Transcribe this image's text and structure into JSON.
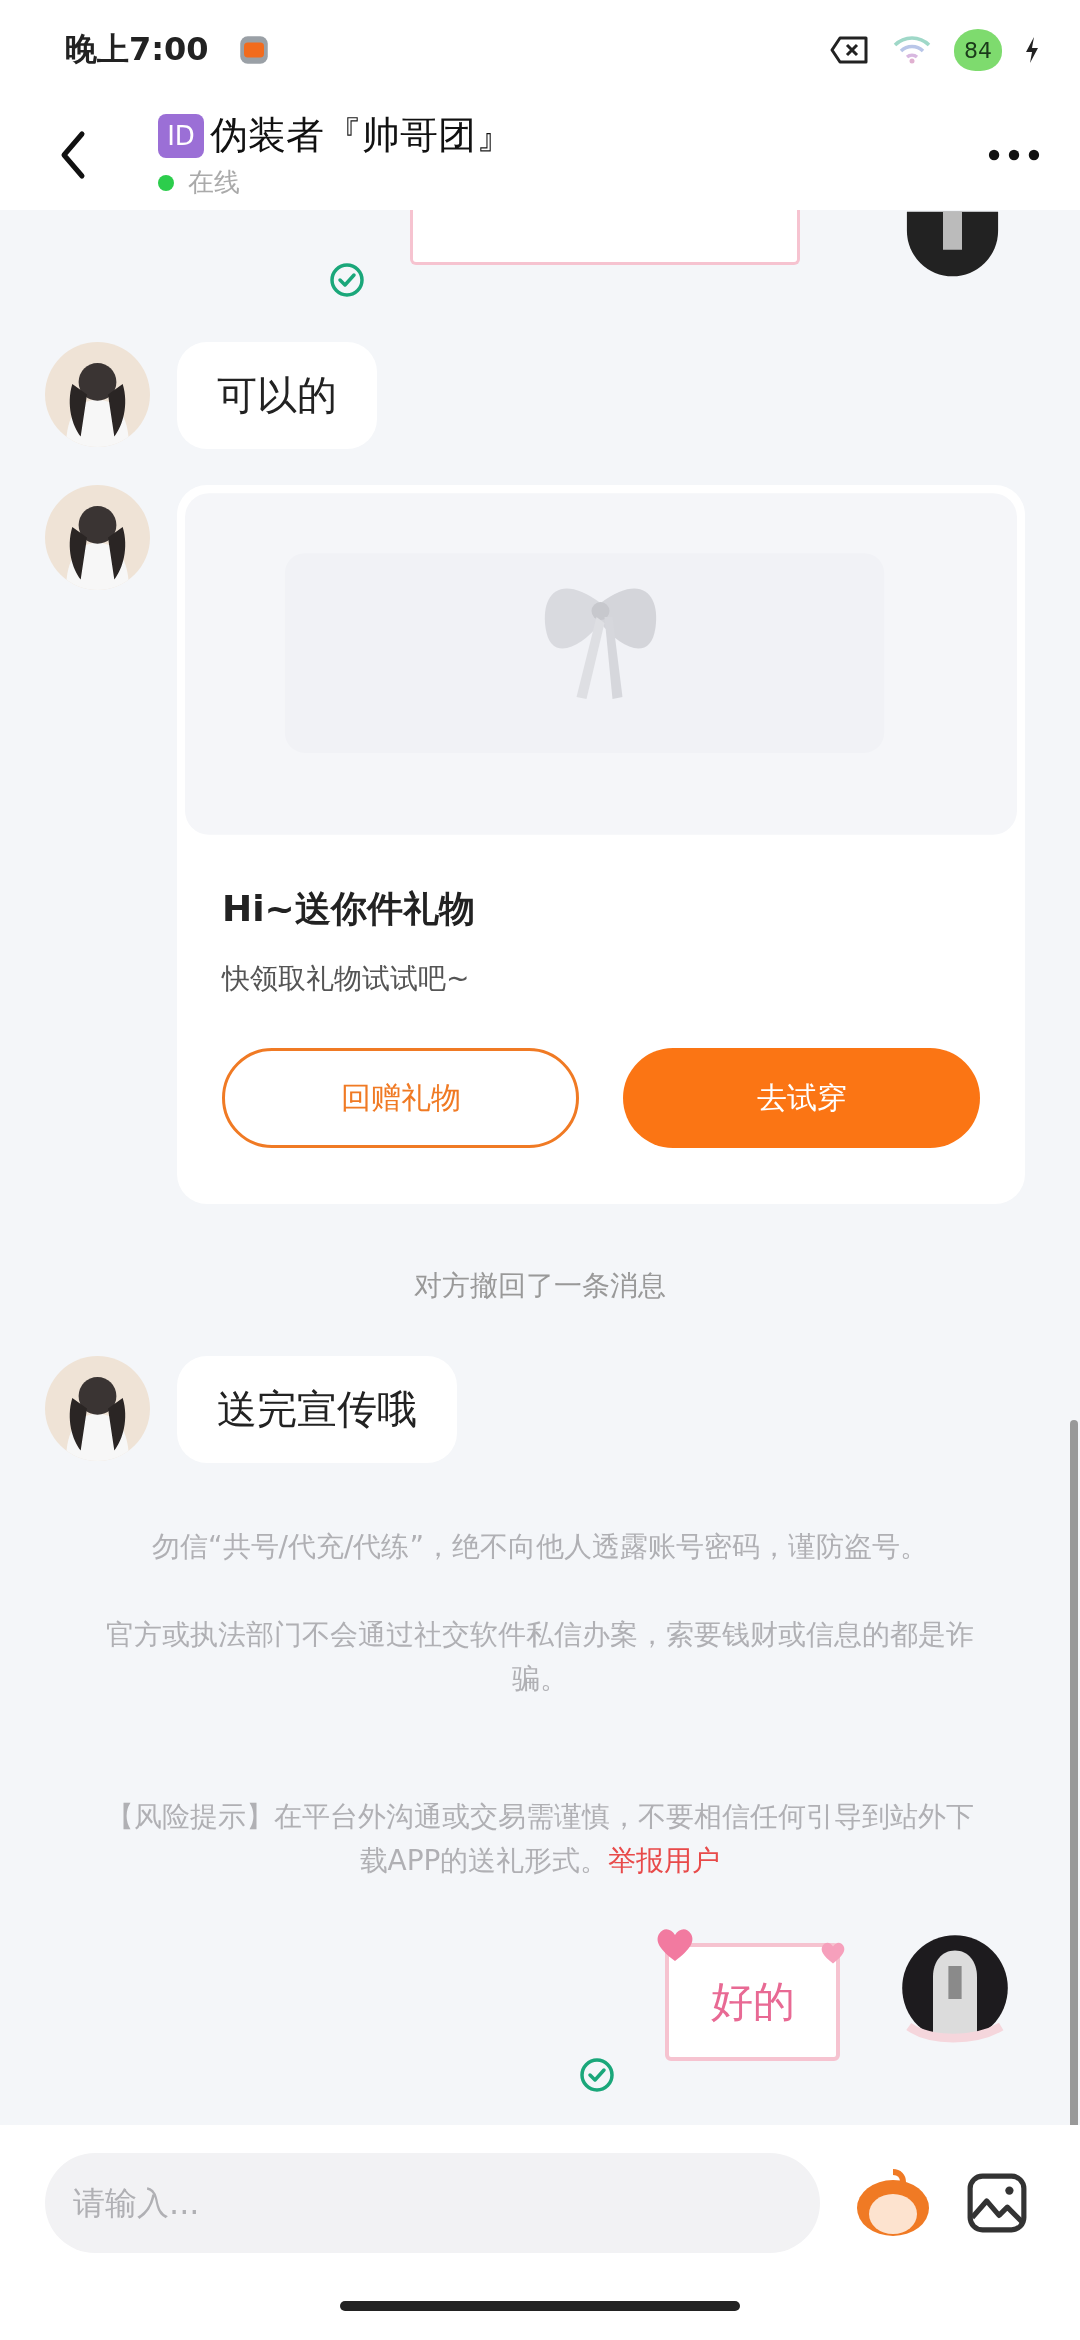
{
  "status_bar": {
    "time": "晚上7:00",
    "battery": "84"
  },
  "header": {
    "badge": "ID",
    "title": "伪装者『帅哥团』",
    "online": true,
    "status": "在线"
  },
  "messages": [
    {
      "kind": "sticker_cut",
      "read": true
    },
    {
      "kind": "text",
      "text": "可以的"
    },
    {
      "kind": "gift",
      "title": "Hi~送你件礼物",
      "subtitle": "快领取礼物试试吧~",
      "buttons": [
        {
          "label": "回赠礼物",
          "kind": "outline"
        },
        {
          "label": "去试穿",
          "kind": "filled"
        }
      ]
    },
    {
      "kind": "notice",
      "text": "对方撤回了一条消息"
    },
    {
      "kind": "text",
      "text": "送完宣传哦"
    },
    {
      "kind": "warning",
      "paragraphs": [
        {
          "text": "勿信“共号/代充/代练”，绝不向他人透露账号密码，谨防盗号。"
        },
        {
          "text": "官方或执法部门不会通过社交软件私信办案，索要钱财或信息的都是诈骗。"
        },
        {
          "text": "【风险提示】在平台外沟通或交易需谨慎，不要相信任何引导到站外下载APP的送礼形式。",
          "link": "举报用户"
        }
      ]
    },
    {
      "kind": "sticker",
      "text": "好的",
      "read": true
    }
  ],
  "composer": {
    "placeholder": "请输入..."
  }
}
